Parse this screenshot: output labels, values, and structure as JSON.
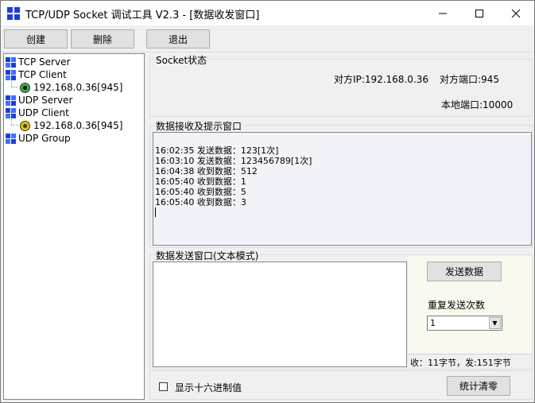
{
  "window": {
    "title": "TCP/UDP Socket 调试工具 V2.3 - [数据收发窗口]"
  },
  "toolbar": {
    "create": "创建",
    "delete": "删除",
    "exit": "退出"
  },
  "tree": {
    "tcp_server": "TCP Server",
    "tcp_client": "TCP Client",
    "tcp_client_conn": "192.168.0.36[945]",
    "udp_server": "UDP Server",
    "udp_client": "UDP Client",
    "udp_client_conn": "192.168.0.36[945]",
    "udp_group": "UDP Group"
  },
  "socket_status": {
    "legend": "Socket状态",
    "peer_ip": "对方IP:192.168.0.36",
    "peer_port": "对方端口:945",
    "local_port": "本地端口:10000"
  },
  "receive": {
    "legend": "数据接收及提示窗口",
    "lines": [
      "16:02:35 发送数据：123[1次]",
      "16:03:10 发送数据：123456789[1次]",
      "16:04:38 收到数据：512",
      "16:05:40 收到数据：1",
      "16:05:40 收到数据：5",
      "16:05:40 收到数据：3"
    ]
  },
  "send": {
    "legend": "数据发送窗口(文本模式)",
    "button": "发送数据",
    "repeat_label": "重复发送次数",
    "repeat_value": "1",
    "stats": "收：11字节，发:151字节"
  },
  "bottom": {
    "hex_label": "显示十六进制值",
    "clear_stats": "统计清零"
  }
}
